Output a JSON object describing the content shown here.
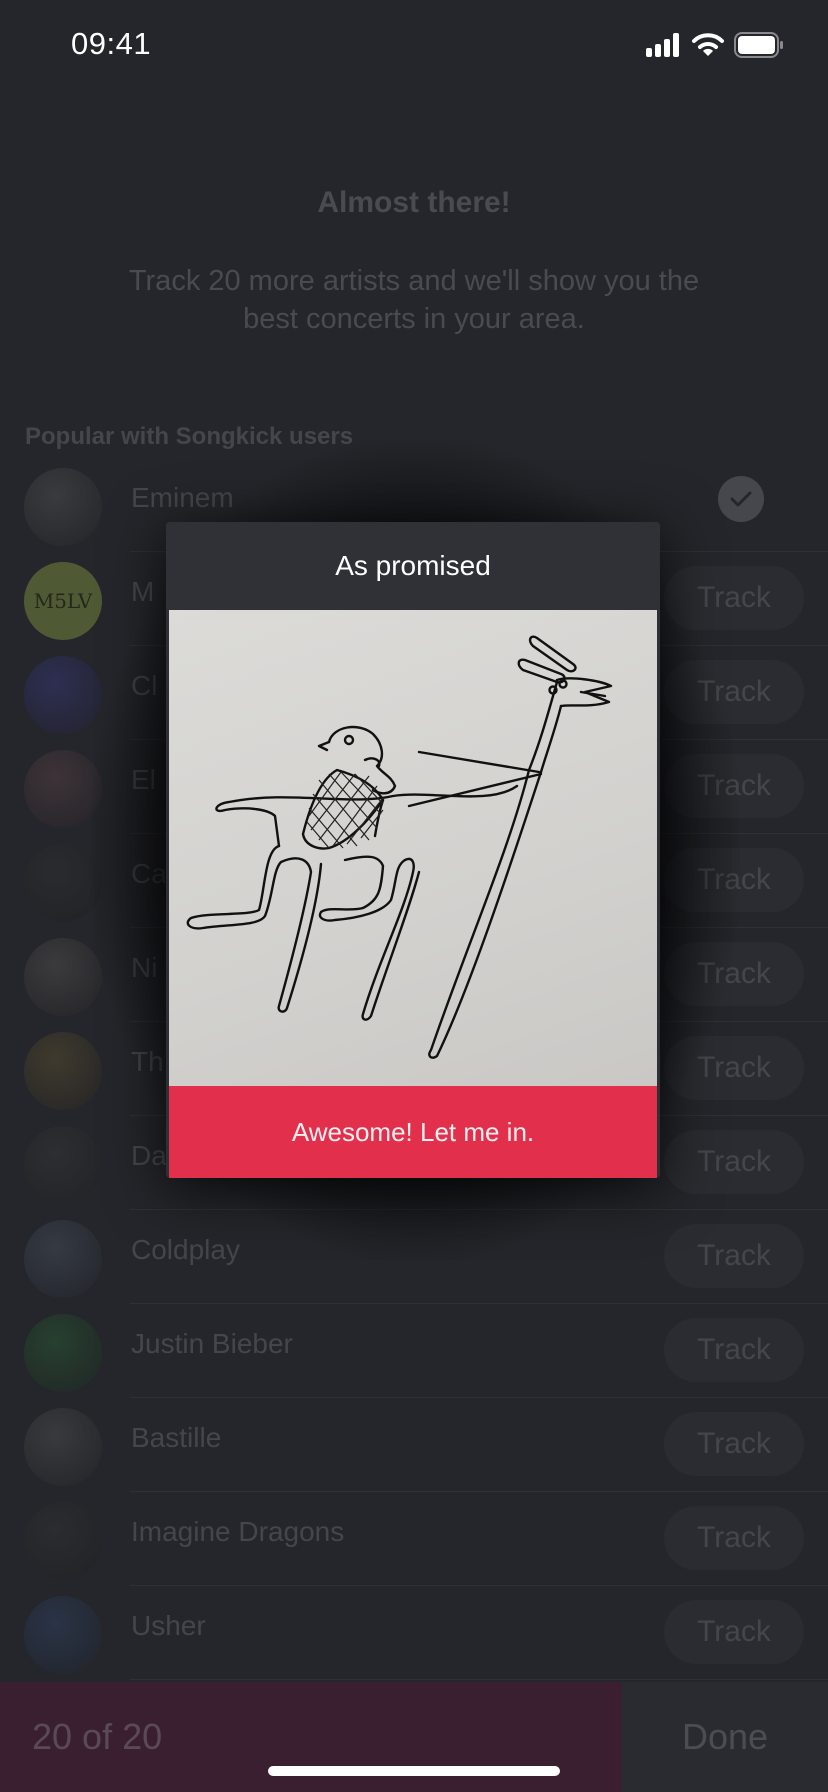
{
  "status_bar": {
    "time": "09:41",
    "icons": [
      "signal-icon",
      "wifi-icon",
      "battery-icon"
    ]
  },
  "onboarding": {
    "heading": "Almost there!",
    "subtext": "Track 20 more artists and we'll show you the best concerts in your area.",
    "section_label": "Popular with Songkick users"
  },
  "artists": [
    {
      "name": "Eminem",
      "tracked": true,
      "avatar_color": "#3a3b3f"
    },
    {
      "name": "M",
      "tracked": false,
      "avatar_color": "#4f5a34",
      "avatar_text": "M5LV"
    },
    {
      "name": "Cl",
      "tracked": false,
      "avatar_color": "#2e2f52"
    },
    {
      "name": "El",
      "tracked": false,
      "avatar_color": "#3d3338"
    },
    {
      "name": "Ca",
      "tracked": false,
      "avatar_color": "#2a2b2e"
    },
    {
      "name": "Ni",
      "tracked": false,
      "avatar_color": "#3b3a3c"
    },
    {
      "name": "Th",
      "tracked": false,
      "avatar_color": "#3f3a2e"
    },
    {
      "name": "Da",
      "tracked": false,
      "avatar_color": "#2d2e31"
    },
    {
      "name": "Coldplay",
      "tracked": false,
      "avatar_color": "#353a44"
    },
    {
      "name": "Justin Bieber",
      "tracked": false,
      "avatar_color": "#27402f"
    },
    {
      "name": "Bastille",
      "tracked": false,
      "avatar_color": "#393a3d"
    },
    {
      "name": "Imagine Dragons",
      "tracked": false,
      "avatar_color": "#2b2c2f"
    },
    {
      "name": "Usher",
      "tracked": false,
      "avatar_color": "#2a3447"
    }
  ],
  "track_label": "Track",
  "bottom_bar": {
    "counter": "20 of 20",
    "done_label": "Done"
  },
  "modal": {
    "title": "As promised",
    "image_alt": "Hand-drawn sketch of a bird riding a long-necked creature",
    "cta_label": "Awesome! Let me in.",
    "cta_color": "#e2304c"
  }
}
